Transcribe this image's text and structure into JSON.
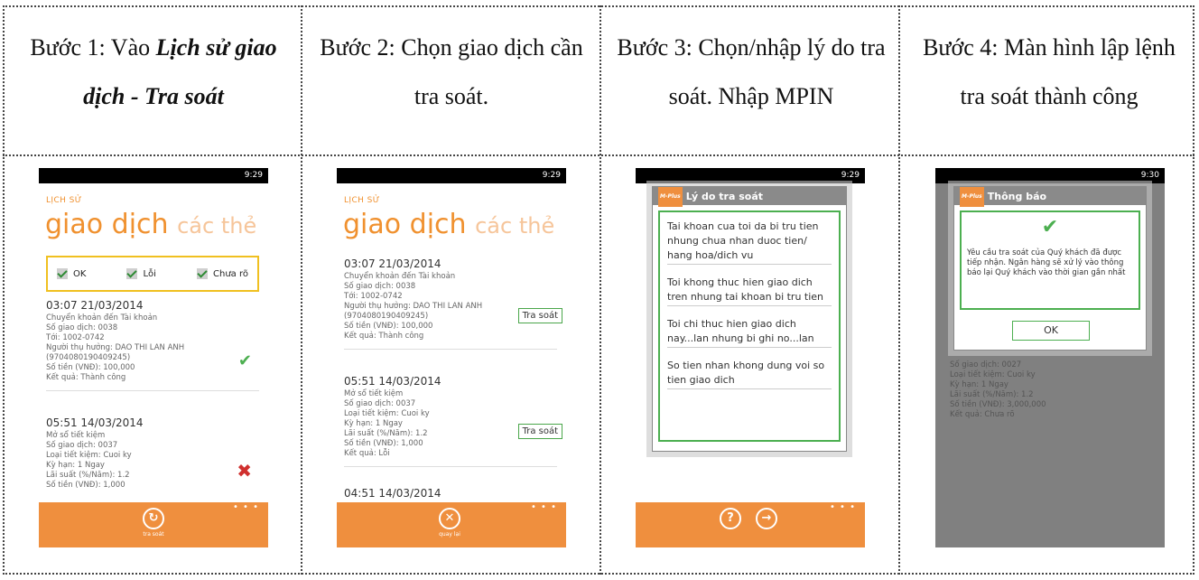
{
  "steps": [
    {
      "prefix": "Bước 1: Vào ",
      "bold": "Lịch sử giao dịch - Tra soát",
      "text": ""
    },
    {
      "text": "Bước 2: Chọn giao dịch cần tra soát."
    },
    {
      "text": "Bước 3: Chọn/nhập lý do tra soát. Nhập MPIN"
    },
    {
      "text": "Bước 4: Màn hình lập lệnh tra soát thành công"
    }
  ],
  "screen1": {
    "clock": "9:29",
    "page_title": "LỊCH SỬ",
    "pivot_active": "giao dịch",
    "pivot_inactive": "các thẻ",
    "filters": [
      "OK",
      "Lỗi",
      "Chưa rõ"
    ],
    "tx1": {
      "time": "03:07 21/03/2014",
      "lines": [
        "Chuyển khoản đến  Tài khoản",
        "Số giao dịch: 0038",
        "Tới: 1002-0742",
        "Người thụ hưởng: DAO THI LAN ANH",
        "(9704080190409245)",
        "Số tiền (VNĐ): 100,000",
        "Kết quả: Thành công"
      ]
    },
    "tx2": {
      "time": "05:51 14/03/2014",
      "lines": [
        "Mở sổ tiết kiệm",
        "Số giao dịch: 0037",
        "Loại tiết kiệm: Cuoi ky",
        "Kỳ hạn: 1 Ngay",
        "Lãi suất (%/Năm): 1.2",
        "Số tiền (VNĐ): 1,000"
      ]
    },
    "appbar_label": "tra soát",
    "appbar_icon": "refresh-icon"
  },
  "screen2": {
    "clock": "9:29",
    "page_title": "LỊCH SỬ",
    "pivot_active": "giao dịch",
    "pivot_inactive": "các thẻ",
    "tx1": {
      "time": "03:07 21/03/2014",
      "lines": [
        "Chuyển khoản đến  Tài khoản",
        "Số giao dịch: 0038",
        "Tới: 1002-0742",
        "Người thụ hưởng: DAO THI LAN ANH",
        "(9704080190409245)",
        "Số tiền (VNĐ): 100,000",
        "Kết quả: Thành công"
      ]
    },
    "tx2": {
      "time": "05:51 14/03/2014",
      "lines": [
        "Mở sổ tiết kiệm",
        "Số giao dịch: 0037",
        "Loại tiết kiệm: Cuoi ky",
        "Kỳ hạn: 1 Ngay",
        "Lãi suất (%/Năm): 1.2",
        "Số tiền (VNĐ): 1,000",
        "Kết quả: Lỗi"
      ]
    },
    "tx3_time": "04:51 14/03/2014",
    "trasoat_label": "Tra soát",
    "appbar_label": "quay lại"
  },
  "screen3": {
    "clock": "9:29",
    "dialog_badge": "M-Plus",
    "dialog_title": "Lý do tra soát",
    "reasons": [
      "Tai khoan cua toi da bi tru tien nhung chua nhan duoc tien/ hang hoa/dich vu",
      "Toi khong thuc hien giao dich tren nhung tai khoan bi tru tien",
      "Toi chi thuc hien giao dich nay...lan nhung bi ghi no...lan",
      "So tien nhan khong dung voi so tien giao dich"
    ]
  },
  "screen4": {
    "clock": "9:30",
    "dialog_badge": "M-Plus",
    "dialog_title": "Thông báo",
    "message": "Yêu cầu tra soát của Quý khách đã được tiếp nhận. Ngân hàng sẽ xử lý vào thông báo lại Quý khách vào thời gian gần nhất",
    "ok_label": "OK",
    "bg_lines": [
      "Số giao dịch: 0027",
      "Loại tiết kiệm: Cuoi ky",
      "Kỳ hạn: 1 Ngay",
      "Lãi suất (%/Năm): 1.2",
      "Số tiền (VNĐ): 3,000,000",
      "Kết quả: Chưa rõ"
    ]
  }
}
